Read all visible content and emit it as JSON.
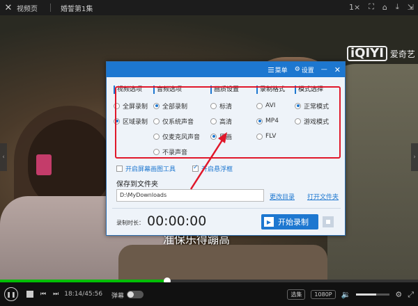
{
  "topbar": {
    "back_label": "视频页",
    "title": "婚誓第1集",
    "speed_label": "1×"
  },
  "video": {
    "brand_logo": "iQIYI",
    "brand_text": "爱奇艺",
    "subtitle": "准保乐得蹦高"
  },
  "dialog": {
    "menu_label": "菜单",
    "settings_label": "设置",
    "columns": [
      {
        "heading": "视频选项",
        "options": [
          {
            "label": "全屏录制",
            "selected": false
          },
          {
            "label": "区域录制",
            "selected": true
          }
        ]
      },
      {
        "heading": "音频选项",
        "options": [
          {
            "label": "全部录制",
            "selected": true
          },
          {
            "label": "仅系统声音",
            "selected": false
          },
          {
            "label": "仅麦克风声音",
            "selected": false
          },
          {
            "label": "不录声音",
            "selected": false
          }
        ]
      },
      {
        "heading": "画质设置",
        "options": [
          {
            "label": "标清",
            "selected": false
          },
          {
            "label": "高清",
            "selected": false
          },
          {
            "label": "原画",
            "selected": true
          }
        ]
      },
      {
        "heading": "录制格式",
        "options": [
          {
            "label": "AVI",
            "selected": false
          },
          {
            "label": "MP4",
            "selected": true
          },
          {
            "label": "FLV",
            "selected": false
          }
        ]
      },
      {
        "heading": "模式选择",
        "options": [
          {
            "label": "正常模式",
            "selected": true
          },
          {
            "label": "游戏模式",
            "selected": false
          }
        ]
      }
    ],
    "check_screenshot": {
      "label": "开启屏幕画图工具",
      "checked": false
    },
    "check_float": {
      "label": "开启悬浮框",
      "checked": true
    },
    "save_label": "保存到文件夹",
    "path_value": "D:\\MyDownloads",
    "change_dir": "更改目录",
    "open_folder": "打开文件夹",
    "record_time_label": "录制时长：",
    "timer": "00:00:00",
    "start_label": "开始录制"
  },
  "controls": {
    "time": "18:14/45:56",
    "danmu": "弹幕",
    "select_label": "选集",
    "quality": "1080P",
    "progress_fraction": 0.4
  },
  "colors": {
    "accent": "#1d77d0",
    "highlight": "#e0172a",
    "progress": "#00be06"
  }
}
